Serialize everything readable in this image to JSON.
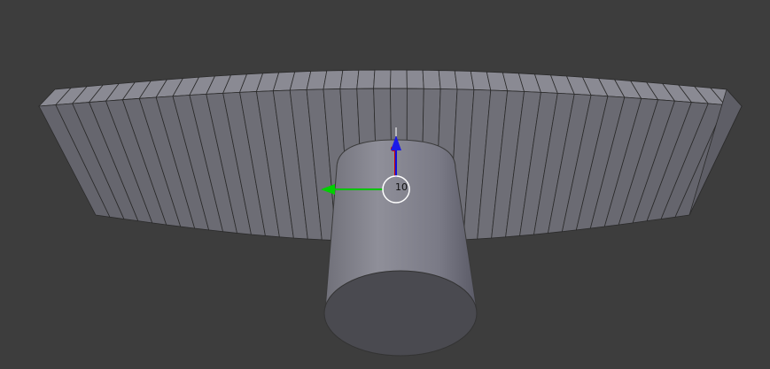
{
  "viewport": {
    "background": "#3d3d3d"
  },
  "objects": [
    {
      "name": "curved-wall",
      "description_color": "#6c6c74"
    },
    {
      "name": "cylinder",
      "description_color": "#8a8a94"
    }
  ],
  "gizmo": {
    "value_label": "10",
    "axis_colors": {
      "x_axis": "#00c400",
      "y_axis": "#c40000",
      "z_axis": "#0000e0"
    }
  },
  "colors": {
    "wall_face": "#6b6b73",
    "wall_top": "#8a8a93",
    "wall_edge": "#2a2a2a",
    "cylinder_side": "#80808a",
    "cylinder_cap": "#4a4a50"
  }
}
